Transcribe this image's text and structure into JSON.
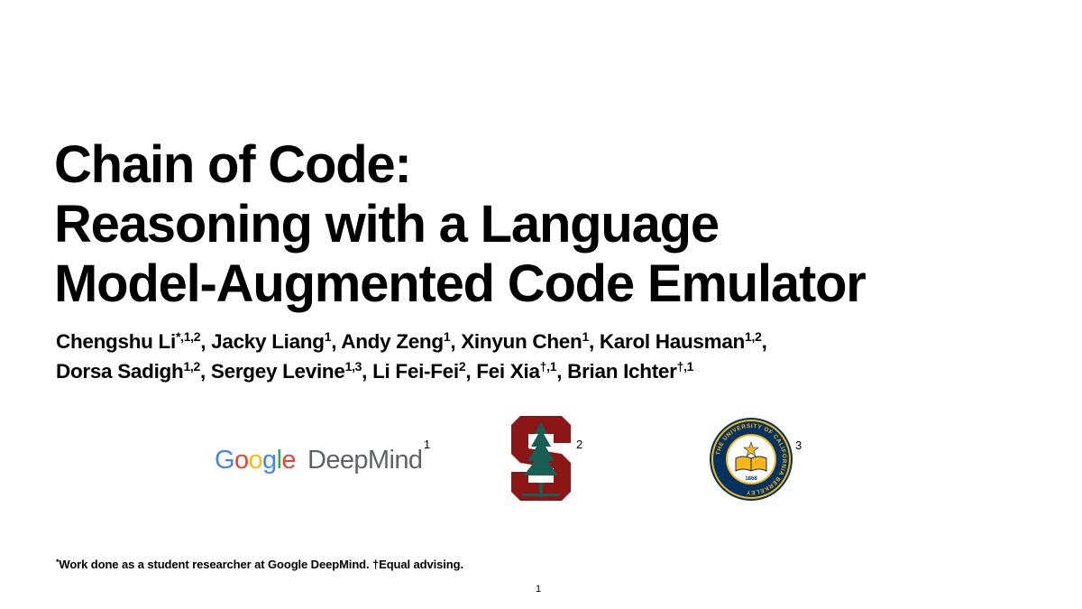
{
  "slide": {
    "title_lines": [
      "Chain of Code:",
      "Reasoning with a Language",
      "Model-Augmented Code Emulator"
    ],
    "authors_lines": [
      [
        {
          "name": "Chengshu Li",
          "sup": "*,1,2"
        },
        {
          "name": "Jacky Liang",
          "sup": "1"
        },
        {
          "name": "Andy Zeng",
          "sup": "1"
        },
        {
          "name": "Xinyun Chen",
          "sup": "1"
        },
        {
          "name": "Karol Hausman",
          "sup": "1,2"
        }
      ],
      [
        {
          "name": "Dorsa Sadigh",
          "sup": "1,2"
        },
        {
          "name": "Sergey Levine",
          "sup": "1,3"
        },
        {
          "name": "Li Fei-Fei",
          "sup": "2"
        },
        {
          "name": "Fei Xia",
          "sup": "†,1"
        },
        {
          "name": "Brian Ichter",
          "sup": "†,1"
        }
      ]
    ],
    "separator": ", ",
    "line_end": ",",
    "logos": {
      "google_deepmind": {
        "google_letters": [
          {
            "ch": "G",
            "color": "#4285F4"
          },
          {
            "ch": "o",
            "color": "#EA4335"
          },
          {
            "ch": "o",
            "color": "#FBBC05"
          },
          {
            "ch": "g",
            "color": "#4285F4"
          },
          {
            "ch": "l",
            "color": "#34A853"
          },
          {
            "ch": "e",
            "color": "#EA4335"
          }
        ],
        "deepmind_text": "DeepMind",
        "deepmind_color": "#5f6368",
        "affiliation": "1"
      },
      "stanford": {
        "affiliation": "2",
        "color": "#8C1515",
        "tree_color": "#175E54"
      },
      "berkeley": {
        "affiliation": "3",
        "seal_text": "THE UNIVERSITY OF CALIFORNIA BERKELEY",
        "year": "1868",
        "blue": "#003262",
        "gold": "#FDB515"
      }
    },
    "footnote": {
      "mark": "*",
      "text": "Work done as a student researcher at Google DeepMind. †Equal advising."
    },
    "page_number": "1"
  }
}
